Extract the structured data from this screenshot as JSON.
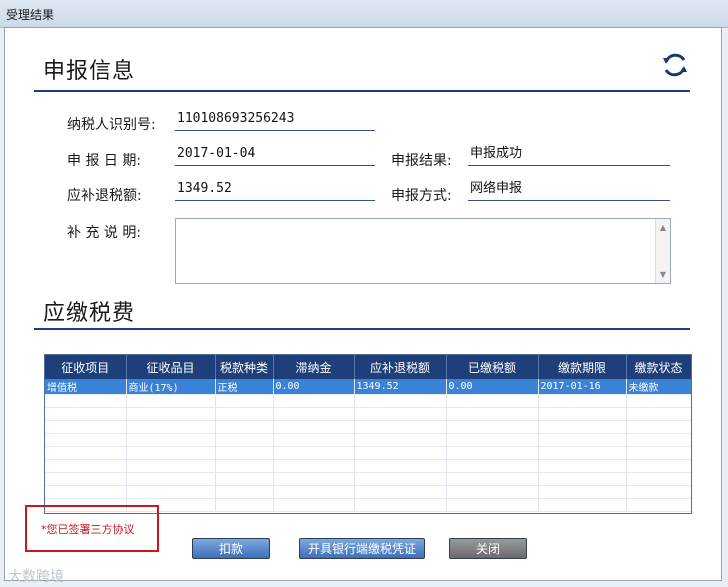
{
  "window": {
    "title": "受理结果"
  },
  "declaration": {
    "heading": "申报信息",
    "taxpayer_id_label": "纳税人识别号:",
    "taxpayer_id": "110108693256243",
    "date_label": "申 报 日 期:",
    "date": "2017-01-04",
    "result_label": "申报结果:",
    "result": "申报成功",
    "amount_label": "应补退税额:",
    "amount": "1349.52",
    "method_label": "申报方式:",
    "method": "网络申报",
    "note_label": "补 充 说 明:",
    "note": ""
  },
  "fees": {
    "heading": "应缴税费",
    "columns": [
      "征收项目",
      "征收品目",
      "税款种类",
      "滞纳金",
      "应补退税额",
      "已缴税额",
      "缴款期限",
      "缴款状态"
    ],
    "rows": [
      [
        "增值税",
        "商业(17%)",
        "正税",
        "0.00",
        "1349.52",
        "0.00",
        "2017-01-16",
        "未缴款"
      ]
    ]
  },
  "notice": "*您已签署三方协议",
  "buttons": {
    "deduct": "扣款",
    "certificate": "开具银行端缴税凭证",
    "close": "关闭"
  },
  "watermark": "大数跨境",
  "icons": {
    "refresh": "refresh-icon"
  },
  "colors": {
    "header_bg": "#1e3f7a",
    "selected_row": "#3a82d6",
    "notice_red": "#c8181d"
  }
}
